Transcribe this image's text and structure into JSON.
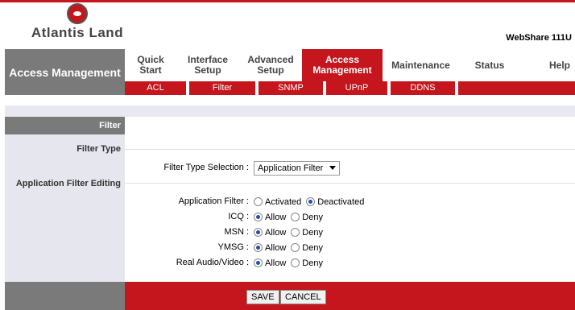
{
  "brand": {
    "logo_text": "Atlantis Land",
    "model": "WebShare 111U",
    "accent": "#c4161c"
  },
  "section_title": "Access Management",
  "tabs": [
    {
      "label": "Quick Start",
      "active": false
    },
    {
      "label": "Interface Setup",
      "active": false
    },
    {
      "label": "Advanced Setup",
      "active": false
    },
    {
      "label": "Access Management",
      "active": true
    },
    {
      "label": "Maintenance",
      "active": false
    },
    {
      "label": "Status",
      "active": false
    },
    {
      "label": "Help",
      "active": false
    }
  ],
  "subtabs": [
    "ACL",
    "Filter",
    "SNMP",
    "UPnP",
    "DDNS"
  ],
  "left": {
    "filter": "Filter",
    "filter_type": "Filter Type",
    "app_filter_editing": "Application Filter Editing"
  },
  "form": {
    "filter_type_label": "Filter Type Selection :",
    "filter_type_value": "Application Filter",
    "app_filter_label": "Application Filter :",
    "activated": "Activated",
    "deactivated": "Deactivated",
    "icq_label": "ICQ :",
    "msn_label": "MSN :",
    "ymsg_label": "YMSG :",
    "real_label": "Real Audio/Video :",
    "allow": "Allow",
    "deny": "Deny"
  },
  "buttons": {
    "save": "SAVE",
    "cancel": "CANCEL"
  }
}
